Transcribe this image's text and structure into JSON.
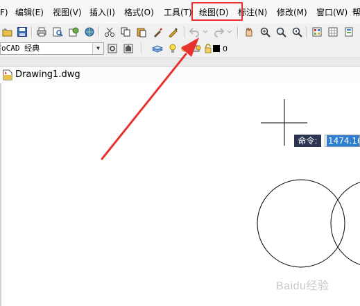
{
  "menu": {
    "items": [
      {
        "label": "F)"
      },
      {
        "label": "编辑(E)"
      },
      {
        "label": "视图(V)"
      },
      {
        "label": "插入(I)"
      },
      {
        "label": "格式(O)"
      },
      {
        "label": "工具(T)"
      },
      {
        "label": "绘图(D)"
      },
      {
        "label": "标注(N)"
      },
      {
        "label": "修改(M)"
      },
      {
        "label": "窗口(W)"
      },
      {
        "label": "帮"
      }
    ],
    "highlight_color": "#e8322e"
  },
  "toolbar2": {
    "workspace_value": "oCAD 经典",
    "layer_value": "0"
  },
  "document": {
    "title": "Drawing1.dwg"
  },
  "command": {
    "label": "命令:",
    "value": "1474.16"
  },
  "watermark": "Baidu经验",
  "colors": {
    "annotation_arrow": "#e8322e",
    "command_label_bg": "#2b3551",
    "command_value_bg": "#2f7fd0"
  }
}
